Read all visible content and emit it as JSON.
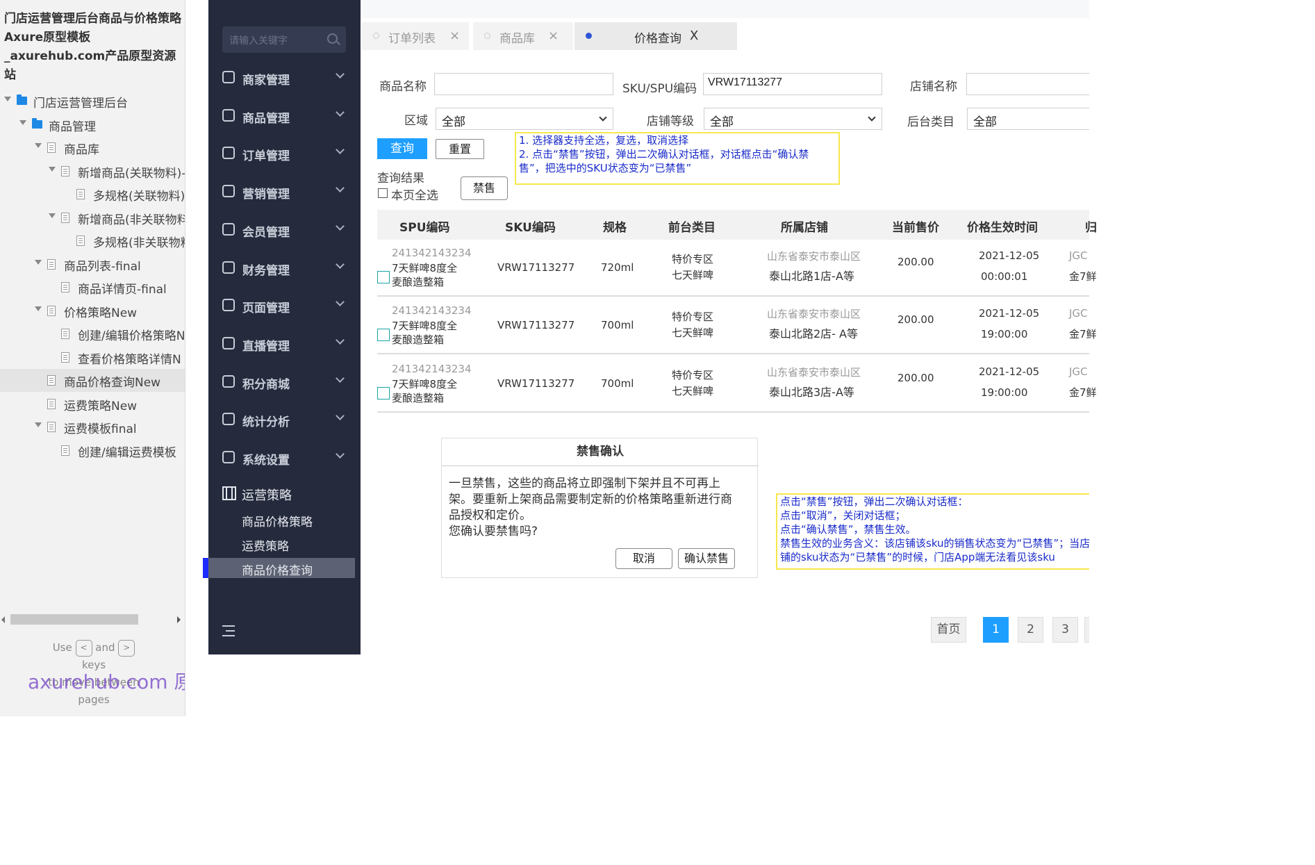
{
  "sitemap": {
    "project_title": "门店运营管理后台商品与价格策略Axure原型模板_axurehub.com产品原型资源站",
    "tree": [
      {
        "label": "门店运营管理后台",
        "type": "folder",
        "expanded": true
      },
      {
        "label": "商品管理",
        "type": "folder",
        "expanded": true
      },
      {
        "label": "商品库",
        "type": "page",
        "expanded": true
      },
      {
        "label": "新增商品(关联物料)-",
        "type": "page",
        "expanded": true
      },
      {
        "label": "多规格(关联物料)",
        "type": "page"
      },
      {
        "label": "新增商品(非关联物料",
        "type": "page",
        "expanded": true
      },
      {
        "label": "多规格(非关联物料",
        "type": "page"
      },
      {
        "label": "商品列表-final",
        "type": "page",
        "expanded": true
      },
      {
        "label": "商品详情页-final",
        "type": "page"
      },
      {
        "label": "价格策略New",
        "type": "page",
        "expanded": true
      },
      {
        "label": "创建/编辑价格策略N",
        "type": "page"
      },
      {
        "label": "查看价格策略详情N",
        "type": "page"
      },
      {
        "label": "商品价格查询New",
        "type": "page",
        "selected": true
      },
      {
        "label": "运费策略New",
        "type": "page"
      },
      {
        "label": "运费模板final",
        "type": "page",
        "expanded": true
      },
      {
        "label": "创建/编辑运费模板",
        "type": "page"
      }
    ],
    "key_hint_use": "Use",
    "key_hint_and": "and",
    "key_hint_rest1": "keys",
    "key_hint_rest2": "to move between",
    "key_hint_rest3": "pages",
    "key_left": "<",
    "key_right": ">",
    "watermark": "axurehub.com 原型资源站"
  },
  "nav": {
    "search_placeholder": "请输入关键字",
    "items": [
      {
        "label": "商家管理",
        "icon": "user-icon"
      },
      {
        "label": "商品管理",
        "icon": "goods-icon"
      },
      {
        "label": "订单管理",
        "icon": "order-icon"
      },
      {
        "label": "营销管理",
        "icon": "marketing-icon"
      },
      {
        "label": "会员管理",
        "icon": "member-icon"
      },
      {
        "label": "财务管理",
        "icon": "finance-icon"
      },
      {
        "label": "页面管理",
        "icon": "page-icon"
      },
      {
        "label": "直播管理",
        "icon": "live-icon"
      },
      {
        "label": "积分商城",
        "icon": "points-icon"
      },
      {
        "label": "统计分析",
        "icon": "stats-icon"
      },
      {
        "label": "系统设置",
        "icon": "settings-icon"
      }
    ],
    "group": {
      "label": "运营策略",
      "icon": "film-icon"
    },
    "subs": [
      {
        "label": "商品价格策略"
      },
      {
        "label": "运费策略"
      },
      {
        "label": "商品价格查询",
        "active": true
      }
    ]
  },
  "tabs": [
    {
      "label": "订单列表",
      "close": "×"
    },
    {
      "label": "商品库",
      "close": "×"
    },
    {
      "label": "价格查询",
      "close": "X",
      "active": true
    }
  ],
  "filters": {
    "product_name_label": "商品名称",
    "product_name_value": "",
    "sku_label": "SKU/SPU编码",
    "sku_value": "VRW17113277",
    "store_name_label": "店铺名称",
    "store_name_value": "",
    "region_label": "区域",
    "region_value": "全部",
    "store_level_label": "店铺等级",
    "store_level_value": "全部",
    "backend_category_label": "后台类目",
    "backend_category_value": "全部"
  },
  "buttons": {
    "query": "查询",
    "reset": "重置",
    "ban": "禁售"
  },
  "note1": {
    "line1": "1. 选择器支持全选，复选，取消选择",
    "line2": "2. 点击“禁售”按钮，弹出二次确认对话框，对话框点击“确认禁",
    "line3": "售”，把选中的SKU状态变为“已禁售”"
  },
  "results": {
    "label": "查询结果",
    "select_all": "本页全选"
  },
  "table": {
    "headers": [
      "SPU编码",
      "SKU编码",
      "规格",
      "前台类目",
      "所属店铺",
      "当前售价",
      "价格生效时间",
      "归"
    ],
    "rows": [
      {
        "spu": "241342143234",
        "name1": "7天鲜啤8度全",
        "name2": "麦酿造整箱",
        "sku": "VRW17113277",
        "spec": "720ml",
        "cat1": "特价专区",
        "cat2": "七天鲜啤",
        "store1": "山东省泰安市泰山区",
        "store2": "泰山北路1店-A等",
        "price": "200.00",
        "date": "2021-12-05",
        "time": "00:00:01",
        "extra1": "JGC",
        "extra2": "金7鲜"
      },
      {
        "spu": "241342143234",
        "name1": "7天鲜啤8度全",
        "name2": "麦酿造整箱",
        "sku": "VRW17113277",
        "spec": "700ml",
        "cat1": "特价专区",
        "cat2": "七天鲜啤",
        "store1": "山东省泰安市泰山区",
        "store2": "泰山北路2店- A等",
        "price": "200.00",
        "date": "2021-12-05",
        "time": "19:00:00",
        "extra1": "JGC",
        "extra2": "金7鲜"
      },
      {
        "spu": "241342143234",
        "name1": "7天鲜啤8度全",
        "name2": "麦酿造整箱",
        "sku": "VRW17113277",
        "spec": "700ml",
        "cat1": "特价专区",
        "cat2": "七天鲜啤",
        "store1": "山东省泰安市泰山区",
        "store2": "泰山北路3店-A等",
        "price": "200.00",
        "date": "2021-12-05",
        "time": "19:00:00",
        "extra1": "JGC",
        "extra2": "金7鲜"
      }
    ]
  },
  "dialog": {
    "title": "禁售确认",
    "line1": "一旦禁售，这些的商品将立即强制下架并且不可再上",
    "line2": "架。要重新上架商品需要制定新的价格策略重新进行商",
    "line3": "品授权和定价。",
    "line4": "您确认要禁售吗?",
    "cancel": "取消",
    "confirm": "确认禁售"
  },
  "note2": {
    "line1": "点击“禁售”按钮，弹出二次确认对话框：",
    "line2": "点击“取消”，关闭对话框；",
    "line3": "点击“确认禁售”，禁售生效。",
    "line4": "禁售生效的业务含义：该店铺该sku的销售状态变为“已禁售”；当店",
    "line5": "铺的sku状态为“已禁售”的时候，门店App端无法看见该sku"
  },
  "pagination": {
    "first": "首页",
    "pages": [
      "1",
      "2",
      "3"
    ],
    "current": "1"
  },
  "colors": {
    "nav_bg": "#252b3d",
    "accent": "#1e9fff",
    "note_border": "#f6e84d",
    "note_text": "#1a2bc9",
    "active_marker": "#1c2bff"
  }
}
